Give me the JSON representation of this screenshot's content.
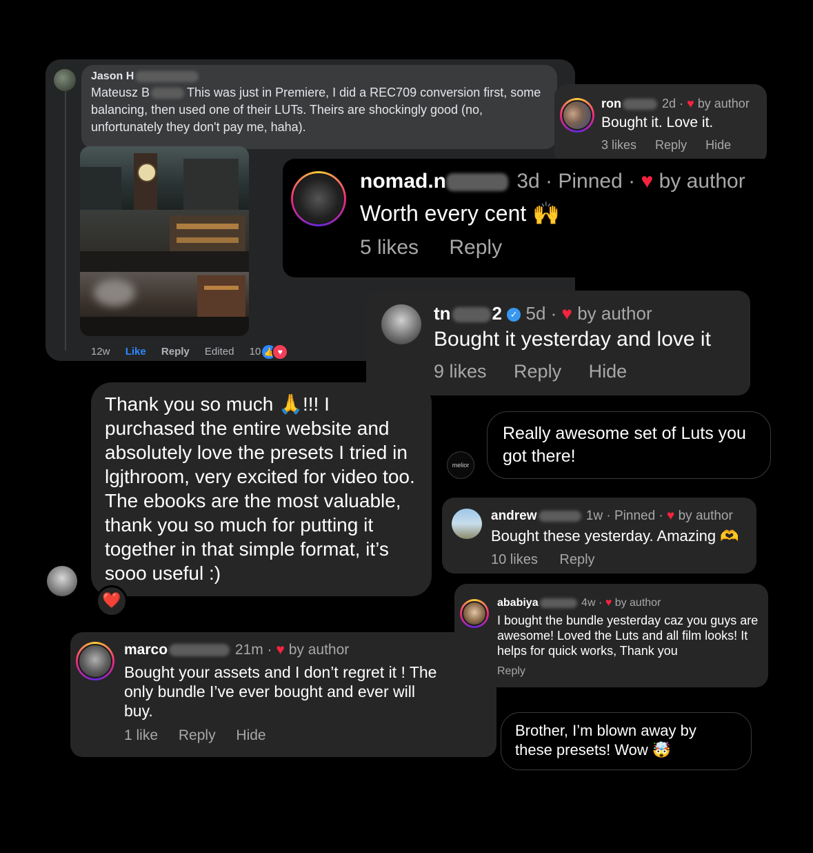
{
  "fb_comment": {
    "author": "Jason H",
    "mention": "Mateusz B",
    "text": "This was just in Premiere, I did a REC709 conversion first, some balancing, then used one of their LUTs. Theirs are shockingly good (no, unfortunately they don't pay me, haha).",
    "time": "12w",
    "like_label": "Like",
    "reply_label": "Reply",
    "edited_label": "Edited",
    "reaction_count": "10"
  },
  "ron": {
    "username": "ron",
    "time": "2d ·",
    "by_author": "by author",
    "text": "Bought it. Love it.",
    "likes": "3 likes",
    "reply": "Reply",
    "hide": "Hide"
  },
  "nomad": {
    "username": "nomad.n",
    "time": "3d · Pinned ·",
    "by_author": "by author",
    "text": "Worth every cent 🙌",
    "likes": "5 likes",
    "reply": "Reply"
  },
  "tn": {
    "username": "tn",
    "username_end": "2",
    "time": "5d ·",
    "by_author": "by author",
    "text": "Bought it yesterday and love it",
    "likes": "9 likes",
    "reply": "Reply",
    "hide": "Hide"
  },
  "thankyou": {
    "text": "Thank you so much 🙏!!! I purchased the entire website and absolutely love the presets I tried in lgjthroom, very excited for video too. The ebooks are the most valuable, thank you so much for putting it together in that simple format, it’s sooo useful :)",
    "reaction": "❤️"
  },
  "awesome": {
    "avatar_label": "melior",
    "text": "Really awesome set of Luts you got there!"
  },
  "andrew": {
    "username": "andrew",
    "time": "1w · Pinned ·",
    "by_author": "by author",
    "text": "Bought these yesterday. Amazing 🫶",
    "likes": "10 likes",
    "reply": "Reply"
  },
  "ababiya": {
    "username": "ababiya",
    "time": "4w ·",
    "by_author": "by author",
    "text": "I bought the bundle yesterday caz you guys are awesome! Loved the Luts and all film looks! It helps for quick works, Thank you",
    "reply": "Reply"
  },
  "marco": {
    "username": "marco",
    "time": "21m ·",
    "by_author": "by author",
    "text": "Bought your assets and I don’t regret it ! The only bundle I’ve ever bought and ever will buy.",
    "likes": "1 like",
    "reply": "Reply",
    "hide": "Hide"
  },
  "brother": {
    "text": "Brother, I’m blown away by these presets! Wow 🤯"
  }
}
